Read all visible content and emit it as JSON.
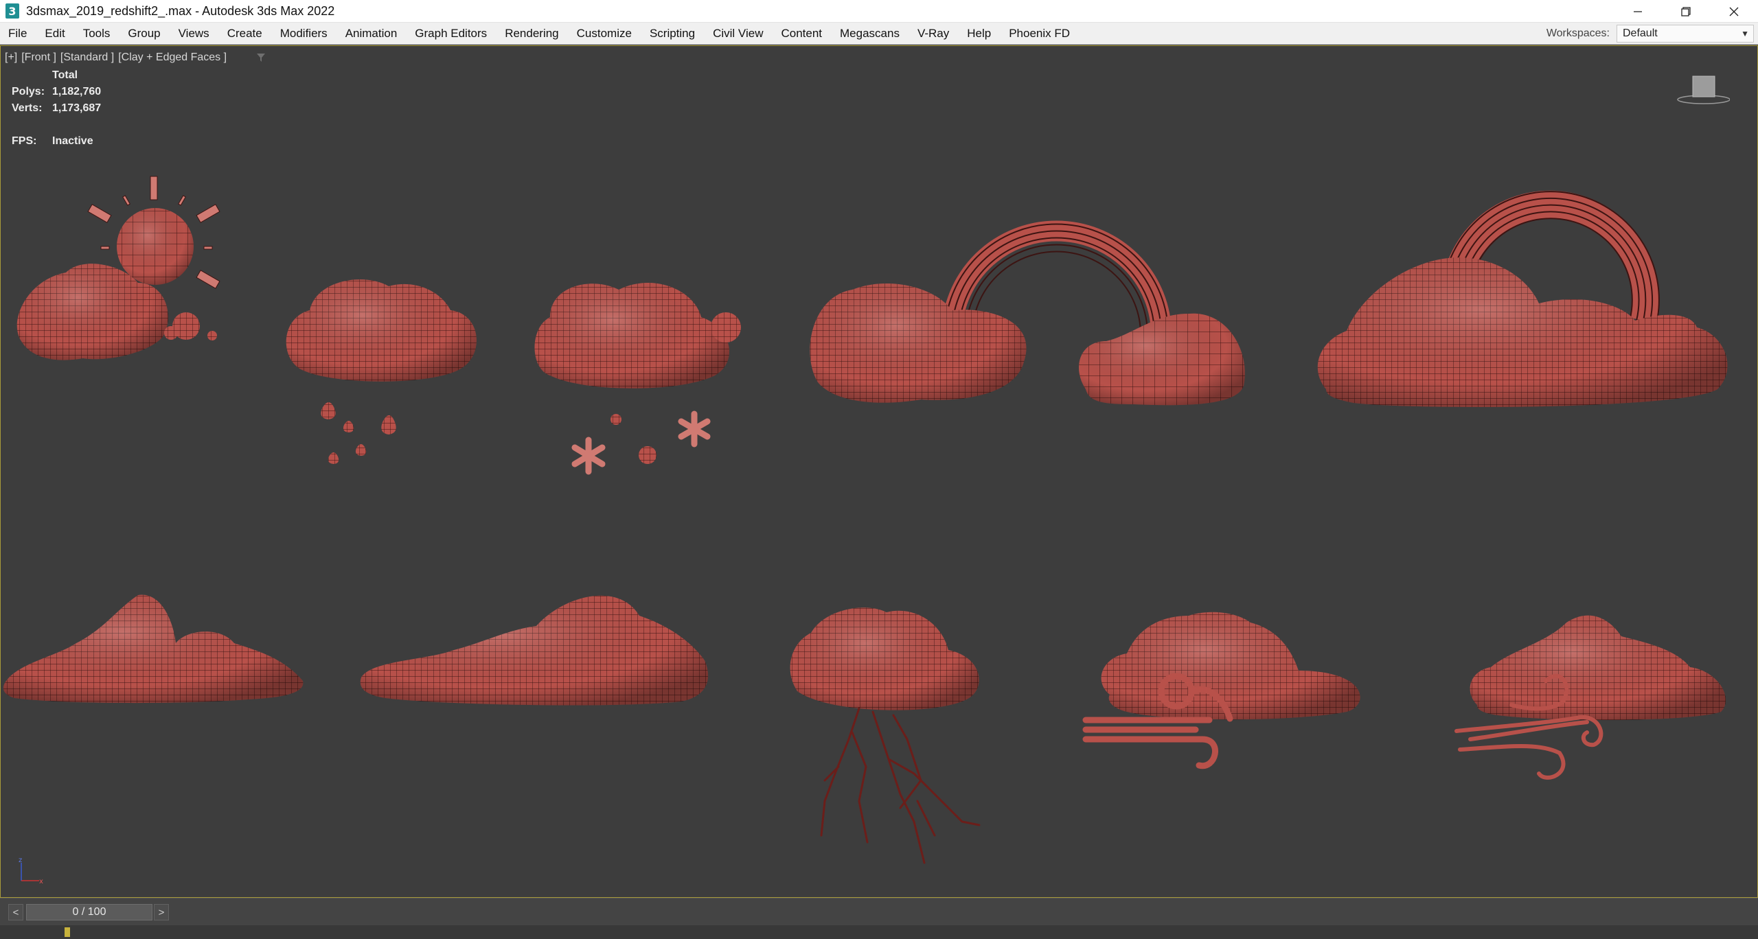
{
  "window": {
    "title": "3dsmax_2019_redshift2_.max - Autodesk 3ds Max 2022",
    "app_icon_glyph": "3"
  },
  "menu": {
    "items": [
      "File",
      "Edit",
      "Tools",
      "Group",
      "Views",
      "Create",
      "Modifiers",
      "Animation",
      "Graph Editors",
      "Rendering",
      "Customize",
      "Scripting",
      "Civil View",
      "Content",
      "Megascans",
      "V-Ray",
      "Help",
      "Phoenix FD"
    ],
    "workspaces_label": "Workspaces:",
    "workspace_value": "Default"
  },
  "viewport": {
    "label_parts": [
      "[+]",
      "[Front ]",
      "[Standard ]",
      "[Clay + Edged Faces ]"
    ],
    "stats": {
      "header": "Total",
      "polys_label": "Polys:",
      "polys_value": "1,182,760",
      "verts_label": "Verts:",
      "verts_value": "1,173,687",
      "fps_label": "FPS:",
      "fps_value": "Inactive"
    },
    "object_color": "#b9524a",
    "background_color": "#3d3d3d"
  },
  "timeline": {
    "prev": "<",
    "next": ">",
    "frame_display": "0 / 100"
  }
}
